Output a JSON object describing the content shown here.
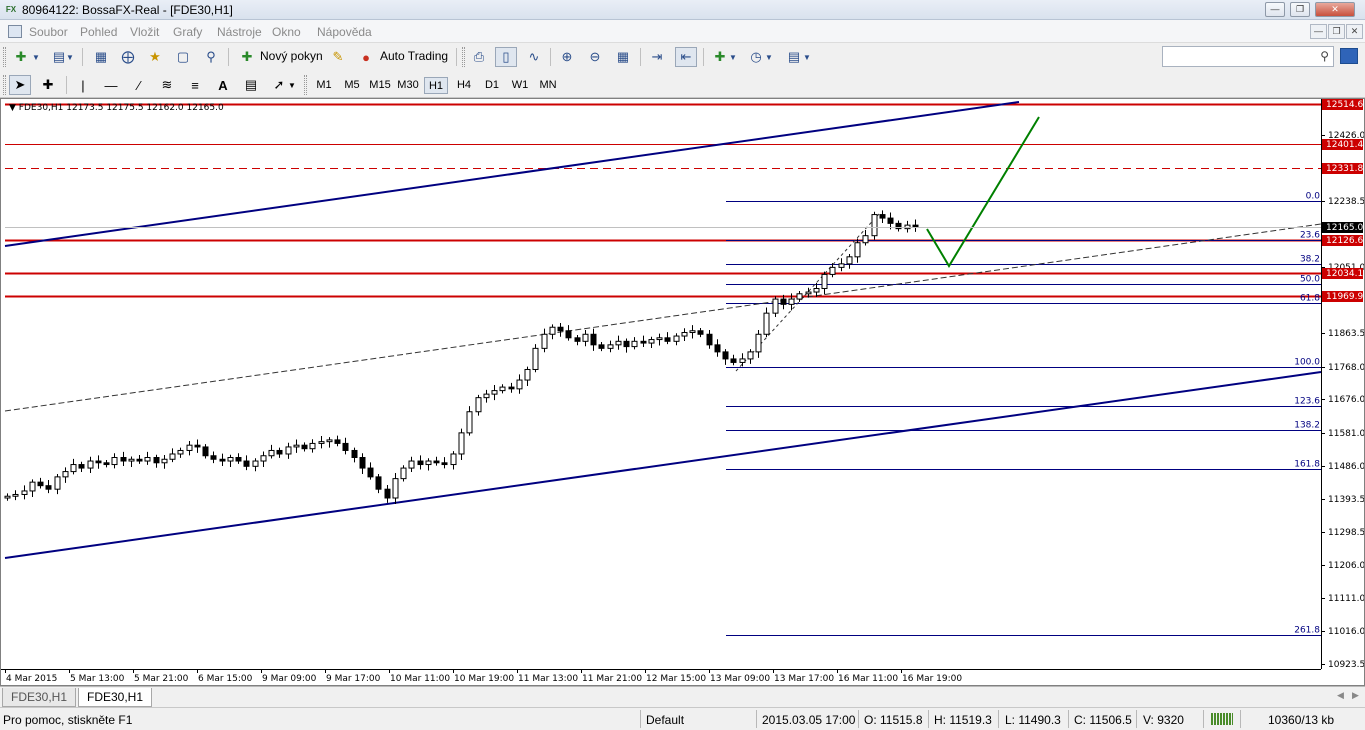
{
  "window": {
    "title": "80964122: BossaFX-Real - [FDE30,H1]",
    "app_icon_label": "FX"
  },
  "menu": {
    "items": [
      "Soubor",
      "Pohled",
      "Vložit",
      "Grafy",
      "Nástroje",
      "Okno",
      "Nápověda"
    ]
  },
  "toolbar": {
    "new_order_label": "Nový pokyn",
    "auto_trading_label": "Auto Trading",
    "search_placeholder": ""
  },
  "timeframes": [
    "M1",
    "M5",
    "M15",
    "M30",
    "H1",
    "H4",
    "D1",
    "W1",
    "MN"
  ],
  "active_timeframe": "H1",
  "chart": {
    "symbol_info": "FDE30,H1  12173.5 12175.5 12162.0 12165.0",
    "current_price": "12165.0",
    "price_ticks": [
      "12426.0",
      "12238.5",
      "12051.0",
      "11863.5",
      "11768.0",
      "11676.0",
      "11581.0",
      "11486.0",
      "11393.5",
      "11298.5",
      "11206.0",
      "11111.0",
      "11016.0",
      "10923.5"
    ],
    "level_labels": [
      "12514.6",
      "12401.4",
      "12331.8",
      "12126.6",
      "12034.1",
      "11969.9"
    ],
    "fib_labels": [
      "0.0",
      "23.6",
      "38.2",
      "50.0",
      "61.8",
      "100.0",
      "123.6",
      "138.2",
      "161.8",
      "261.8"
    ],
    "time_labels": [
      "4 Mar 2015",
      "5 Mar 13:00",
      "5 Mar 21:00",
      "6 Mar 15:00",
      "9 Mar 09:00",
      "9 Mar 17:00",
      "10 Mar 11:00",
      "10 Mar 19:00",
      "11 Mar 13:00",
      "11 Mar 21:00",
      "12 Mar 15:00",
      "13 Mar 09:00",
      "13 Mar 17:00",
      "16 Mar 11:00",
      "16 Mar 19:00"
    ],
    "colors": {
      "level_line": "#cc0000",
      "channel_line": "#000080",
      "fib_line": "#000080",
      "projection": "#008000"
    }
  },
  "tabs": [
    "FDE30,H1",
    "FDE30,H1"
  ],
  "active_tab_index": 1,
  "status": {
    "help": "Pro pomoc, stiskněte F1",
    "profile": "Default",
    "datetime": "2015.03.05 17:00",
    "open": "O: 11515.8",
    "high": "H: 11519.3",
    "low": "L: 11490.3",
    "close": "C: 11506.5",
    "volume": "V: 9320",
    "traffic": "10360/13 kb"
  }
}
